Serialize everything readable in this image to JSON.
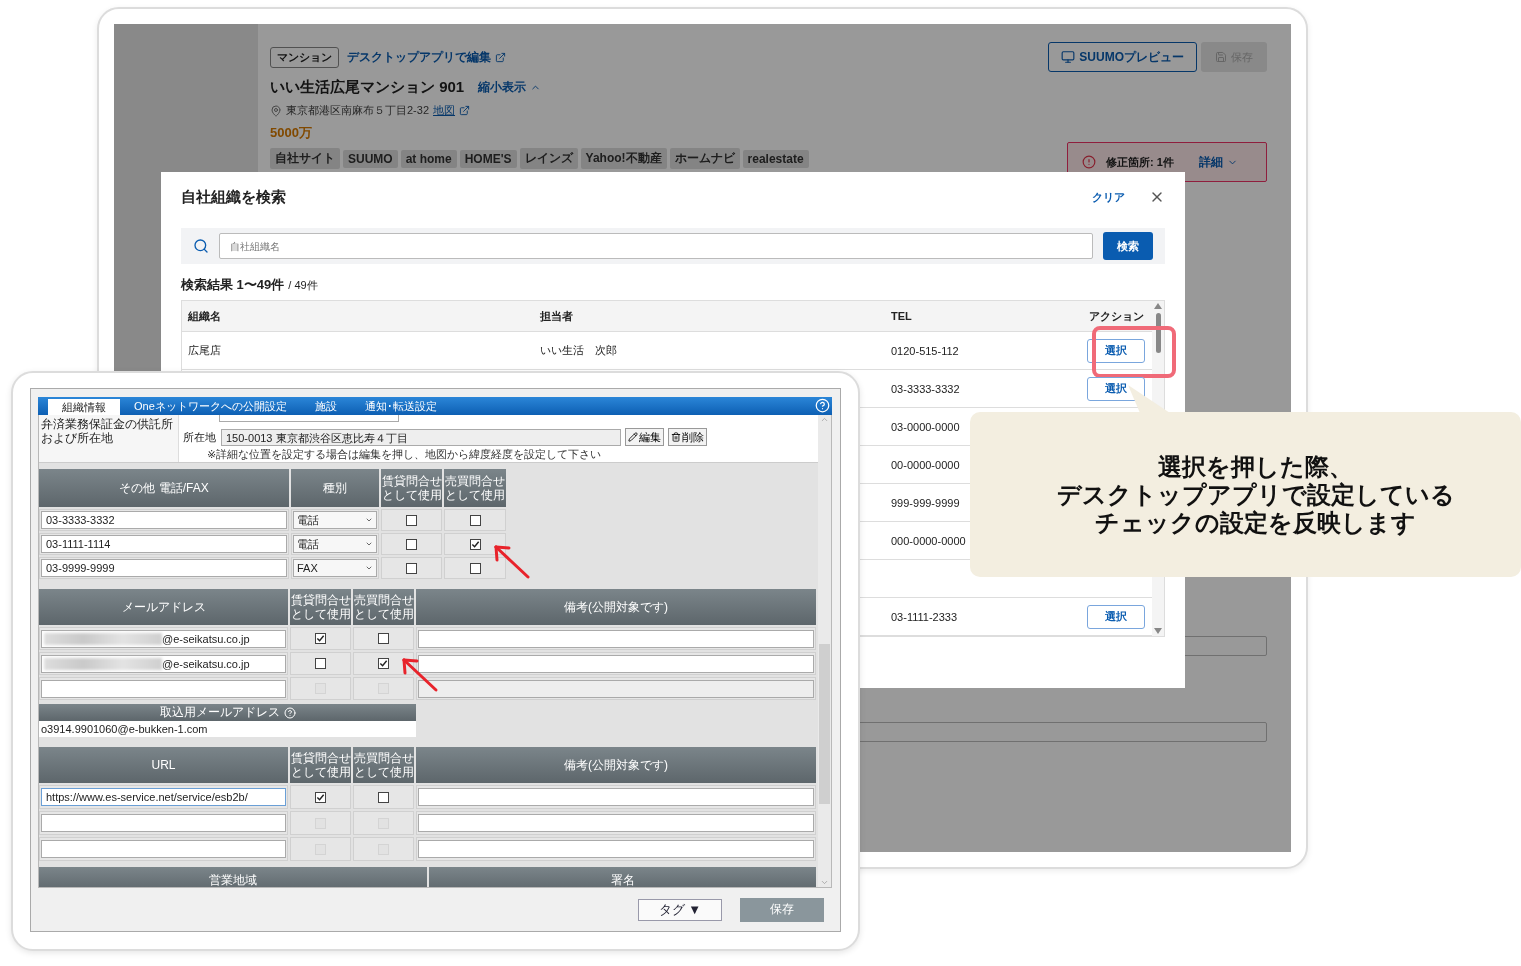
{
  "back_app": {
    "header": {
      "category": "マンション",
      "edit_link": "デスクトップアプリで編集",
      "preview_button": "SUUMOプレビュー",
      "save_button": {
        "label": "保存",
        "disabled": true
      }
    },
    "property": {
      "title": "いい生活広尾マンション 901",
      "collapse_link": "縮小表示",
      "address": "東京都港区南麻布５丁目2-32",
      "map_link": "地図",
      "price": "5000万",
      "tags": [
        "自社サイト",
        "SUUMO",
        "at home",
        "HOME'S",
        "レインズ",
        "Yahoo!不動産",
        "ホームナビ",
        "realestate"
      ]
    },
    "alert": {
      "text": "修正箇所: 1件",
      "details_link": "詳細"
    }
  },
  "search_dialog": {
    "title": "自社組織を検索",
    "clear_link": "クリア",
    "search": {
      "placeholder": "自社組織名",
      "button": "検索"
    },
    "result_count": "検索結果 1〜49件",
    "result_total": "/ 49件",
    "columns": [
      "組織名",
      "担当者",
      "TEL",
      "アクション"
    ],
    "rows": [
      {
        "name": "広尾店",
        "person": "いい生活　次郎",
        "tel": "0120-515-112",
        "action": "選択",
        "highlighted": true
      },
      {
        "tel": "03-3333-3332",
        "action": "選択"
      },
      {
        "tel": "03-0000-0000"
      },
      {
        "tel": "00-0000-0000"
      },
      {
        "tel": "999-999-9999"
      },
      {
        "tel": "000-0000-0000"
      },
      {},
      {
        "tel": "03-1111-2333",
        "action": "選択"
      }
    ]
  },
  "desktop_window": {
    "tabs": [
      {
        "label": "組織情報",
        "selected": true
      },
      {
        "label": "Oneネットワークへの公開設定",
        "selected": false
      },
      {
        "label": "施設",
        "selected": false
      },
      {
        "label": "通知･転送設定",
        "selected": false
      }
    ],
    "deposit": {
      "label": "弁済業務保証金の供託所および所在地",
      "location_label": "所在地",
      "address": "150-0013 東京都渋谷区恵比寿４丁目",
      "edit_button": "編集",
      "delete_button": "削除",
      "note": "※詳細な位置を設定する場合は編集を押し、地図から緯度経度を設定して下さい"
    },
    "phone_table": {
      "columns": [
        "その他 電話/FAX",
        "種別",
        "賃貸問合せとして使用",
        "売買問合せとして使用"
      ],
      "rows": [
        {
          "number": "03-3333-3332",
          "type": "電話",
          "rent": {
            "checked": false,
            "disabled": false
          },
          "sale": {
            "checked": false,
            "disabled": false
          }
        },
        {
          "number": "03-1111-1114",
          "type": "電話",
          "rent": {
            "checked": false,
            "disabled": false
          },
          "sale": {
            "checked": true,
            "disabled": false
          }
        },
        {
          "number": "03-9999-9999",
          "type": "FAX",
          "rent": {
            "checked": false,
            "disabled": false
          },
          "sale": {
            "checked": false,
            "disabled": false
          }
        }
      ]
    },
    "email_table": {
      "columns": [
        "メールアドレス",
        "賃貸問合せとして使用",
        "売買問合せとして使用",
        "備考(公開対象です)"
      ],
      "rows": [
        {
          "address": "@e-seikatsu.co.jp",
          "redacted": true,
          "rent": {
            "checked": true,
            "disabled": false
          },
          "sale": {
            "checked": false,
            "disabled": false
          }
        },
        {
          "address": "@e-seikatsu.co.jp",
          "redacted": true,
          "rent": {
            "checked": false,
            "disabled": false
          },
          "sale": {
            "checked": true,
            "disabled": false
          }
        },
        {
          "rent": {
            "checked": false,
            "disabled": true
          },
          "sale": {
            "checked": false,
            "disabled": true
          }
        }
      ]
    },
    "import_email": {
      "label": "取込用メールアドレス",
      "value": "o3914.9901060@e-bukken-1.com"
    },
    "url_table": {
      "columns": [
        "URL",
        "賃貸問合せとして使用",
        "売買問合せとして使用",
        "備考(公開対象です)"
      ],
      "rows": [
        {
          "url": "https://www.es-service.net/service/esb2b/",
          "rent": {
            "checked": true,
            "disabled": false
          },
          "sale": {
            "checked": false,
            "disabled": false
          }
        },
        {
          "rent": {
            "checked": false,
            "disabled": true
          },
          "sale": {
            "checked": false,
            "disabled": true
          }
        },
        {
          "rent": {
            "checked": false,
            "disabled": true
          },
          "sale": {
            "checked": false,
            "disabled": true
          }
        }
      ]
    },
    "bottom_headers": [
      "営業地域",
      "署名"
    ],
    "footer": {
      "tag_button": "タグ ▼",
      "save_button": "保存"
    }
  },
  "callout": {
    "lines": [
      "選択を押した際、",
      "デスクトップアプリで設定している",
      "チェックの設定を反映します"
    ]
  }
}
